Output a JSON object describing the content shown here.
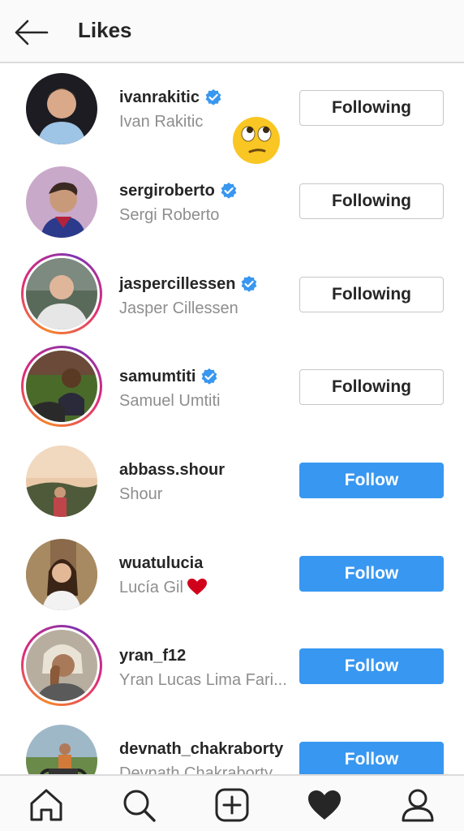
{
  "header": {
    "back_icon": "arrow-left-icon",
    "title": "Likes"
  },
  "buttons": {
    "following_label": "Following",
    "follow_label": "Follow"
  },
  "colors": {
    "follow_blue": "#3897f0",
    "verified_blue": "#3897f0",
    "muted_text": "#8e8e8e",
    "heart_red": "#d0021b"
  },
  "users": [
    {
      "username": "ivanrakitic",
      "full_name": "Ivan Rakitic",
      "verified": true,
      "following": true
    },
    {
      "username": "sergiroberto",
      "full_name": "Sergi Roberto",
      "verified": true,
      "following": true
    },
    {
      "username": "jaspercillessen",
      "full_name": "Jasper Cillessen",
      "verified": true,
      "following": true
    },
    {
      "username": "samumtiti",
      "full_name": "Samuel Umtiti",
      "verified": true,
      "following": true
    },
    {
      "username": "abbass.shour",
      "full_name": "Shour",
      "verified": false,
      "following": false
    },
    {
      "username": "wuatulucia",
      "full_name": "Lucía Gil",
      "verified": false,
      "following": false
    },
    {
      "username": "yran_f12",
      "full_name": "Yran Lucas Lima Fari...",
      "verified": false,
      "following": false
    },
    {
      "username": "devnath_chakraborty",
      "full_name": "Devnath Chakraborty",
      "verified": false,
      "following": false
    }
  ],
  "overlay": {
    "emoji": "face-with-rolling-eyes-emoji"
  },
  "tabbar": {
    "tabs": [
      "home-icon",
      "search-icon",
      "new-post-icon",
      "activity-heart-icon",
      "profile-icon"
    ],
    "active": "activity-heart-icon"
  }
}
